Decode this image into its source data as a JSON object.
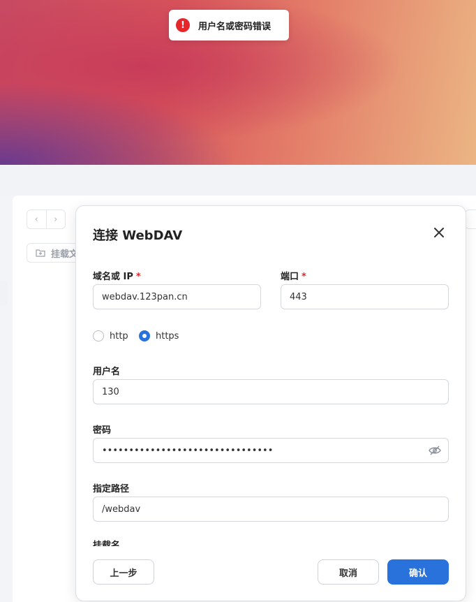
{
  "toast": {
    "message": "用户名或密码错误",
    "icon": "error-icon",
    "icon_glyph": "!"
  },
  "background": {
    "nav_prev": "‹",
    "nav_next": "›",
    "mount_label": "挂载文"
  },
  "dialog": {
    "title": "连接 WebDAV",
    "close_glyph": "✕",
    "host": {
      "label": "域名或 IP",
      "required_mark": "*",
      "value": "webdav.123pan.cn"
    },
    "port": {
      "label": "端口",
      "required_mark": "*",
      "value": "443"
    },
    "protocol": {
      "options": [
        {
          "label": "http",
          "selected": false
        },
        {
          "label": "https",
          "selected": true
        }
      ]
    },
    "username": {
      "label": "用户名",
      "value": "130​​​​​​​​"
    },
    "password": {
      "label": "密码",
      "value": "••••••••••••••••••••••••••••••••"
    },
    "path": {
      "label": "指定路径",
      "value": "/webdav"
    },
    "mount_name": {
      "label": "挂载名"
    },
    "buttons": {
      "prev": "上一步",
      "cancel": "取消",
      "confirm": "确认"
    }
  },
  "colors": {
    "accent": "#2a72db",
    "error": "#e5262b"
  }
}
